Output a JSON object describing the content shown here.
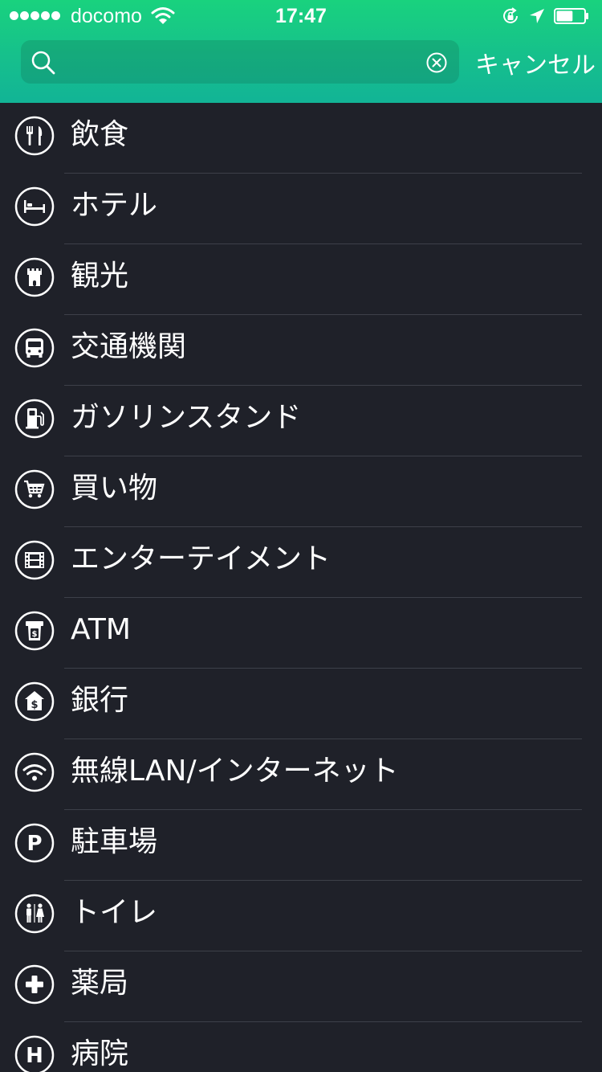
{
  "status_bar": {
    "signal_dots": 5,
    "carrier": "docomo",
    "time": "17:47",
    "battery_level": 0.6,
    "icons": [
      "wifi-icon",
      "rotation-lock-icon",
      "location-arrow-icon",
      "battery-icon"
    ]
  },
  "search": {
    "value": "",
    "placeholder": "",
    "cancel_label": "キャンセル"
  },
  "colors": {
    "header_top": "#19d27e",
    "header_bottom": "#12b496",
    "background": "#1f2129",
    "separator": "#3d4049",
    "text": "#ffffff"
  },
  "categories": [
    {
      "label": "飲食",
      "icon": "restaurant-icon"
    },
    {
      "label": "ホテル",
      "icon": "bed-icon"
    },
    {
      "label": "観光",
      "icon": "tower-icon"
    },
    {
      "label": "交通機関",
      "icon": "bus-icon"
    },
    {
      "label": "ガソリンスタンド",
      "icon": "gas-station-icon"
    },
    {
      "label": "買い物",
      "icon": "shopping-cart-icon"
    },
    {
      "label": "エンターテイメント",
      "icon": "film-icon"
    },
    {
      "label": "ATM",
      "icon": "atm-icon"
    },
    {
      "label": "銀行",
      "icon": "bank-icon"
    },
    {
      "label": "無線LAN/インターネット",
      "icon": "wifi-icon"
    },
    {
      "label": "駐車場",
      "icon": "parking-icon"
    },
    {
      "label": "トイレ",
      "icon": "restroom-icon"
    },
    {
      "label": "薬局",
      "icon": "pharmacy-icon"
    },
    {
      "label": "病院",
      "icon": "hospital-icon"
    }
  ]
}
